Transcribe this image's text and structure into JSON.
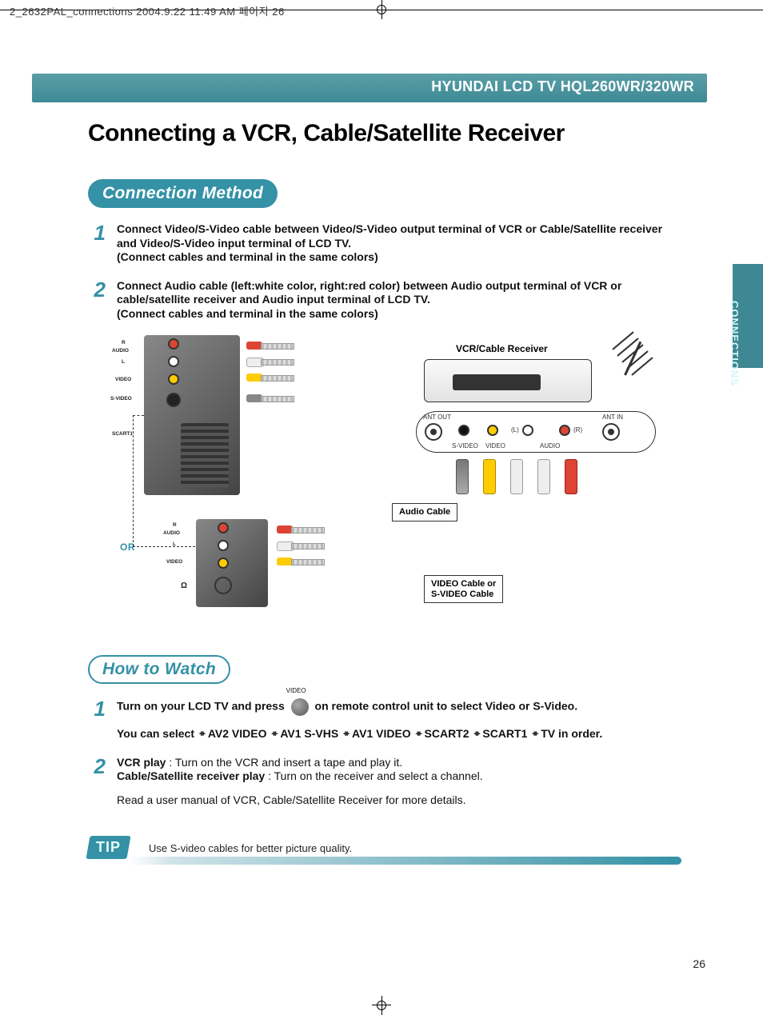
{
  "crop_header": "2_2632PAL_connections  2004.9.22 11:49 AM  페이지 26",
  "header_product": "HYUNDAI LCD TV HQL260WR/320WR",
  "side_tab": "CONNECTIONS",
  "title": "Connecting a VCR, Cable/Satellite Receiver",
  "section_connection": "Connection Method",
  "steps": {
    "s1_num": "1",
    "s1_line1": "Connect Video/S-Video cable between Video/S-Video output terminal of VCR or Cable/Satellite receiver and Video/S-Video input terminal of LCD TV.",
    "s1_line2": "(Connect cables and terminal in the same colors)",
    "s2_num": "2",
    "s2_line1": "Connect Audio cable (left:white color, right:red color) between Audio output terminal of VCR or cable/satellite receiver and Audio input terminal of LCD TV.",
    "s2_line2": "(Connect cables and terminal in the same colors)"
  },
  "diagram": {
    "vcr_label": "VCR/Cable Receiver",
    "ant_out": "ANT OUT",
    "ant_in": "ANT  IN",
    "svideo": "S-VIDEO",
    "video": "VIDEO",
    "audio": "AUDIO",
    "l": "(L)",
    "r": "(R)",
    "audio_cable": "Audio Cable",
    "video_cable_1": "VIDEO Cable or",
    "video_cable_2": "S-VIDEO Cable",
    "or": "OR",
    "tv_audio": "AUDIO",
    "tv_l": "L",
    "tv_r": "R",
    "tv_video": "VIDEO",
    "tv_svideo": "S-VIDEO",
    "tv_scart": "SCART1",
    "inline_button": "VIDEO"
  },
  "section_howto": "How to Watch",
  "howto": {
    "h1_num": "1",
    "h1_a": "Turn on your LCD TV and press",
    "h1_b": "on remote control unit to select",
    "h1_c": "Video",
    "h1_d": "or",
    "h1_e": "S-Video.",
    "h1_line2_a": "You can select",
    "seq": [
      "AV2 VIDEO",
      "AV1 S-VHS",
      "AV1 VIDEO",
      "SCART2",
      "SCART1",
      "TV in order."
    ],
    "h2_num": "2",
    "h2_a": "VCR play",
    "h2_b": ": Turn on the VCR and insert a tape and play it.",
    "h2_c": "Cable/Satellite receiver play",
    "h2_d": ": Turn on the receiver and select a channel.",
    "h2_e": "Read a user manual of VCR, Cable/Satellite Receiver for more details."
  },
  "tip_label": "TIP",
  "tip_text": "Use S-video cables for better picture quality.",
  "page_number": "26"
}
